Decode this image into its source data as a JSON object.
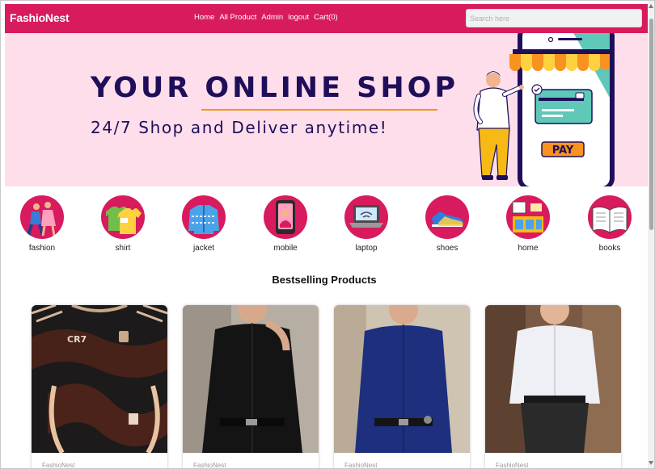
{
  "navbar": {
    "brand": "FashioNest",
    "links": [
      "Home",
      "All Product",
      "Admin",
      "logout",
      "Cart(0)"
    ],
    "search_placeholder": "Search here"
  },
  "hero": {
    "title": "YOUR ONLINE SHOP",
    "subtitle": "24/7 Shop and Deliver anytime!",
    "pay_label": "PAY"
  },
  "categories": [
    "fashion",
    "shirt",
    "jacket",
    "mobile",
    "laptop",
    "shoes",
    "home",
    "books"
  ],
  "section_title": "Bestselling Products",
  "products": [
    {
      "brand": "FashioNest"
    },
    {
      "brand": "FashioNest"
    },
    {
      "brand": "FashioNest"
    },
    {
      "brand": "FashioNest"
    }
  ],
  "colors": {
    "primary": "#d81b5e",
    "hero_bg": "#fedeeb",
    "hero_text": "#1f0f5a",
    "accent": "#f7931e"
  }
}
